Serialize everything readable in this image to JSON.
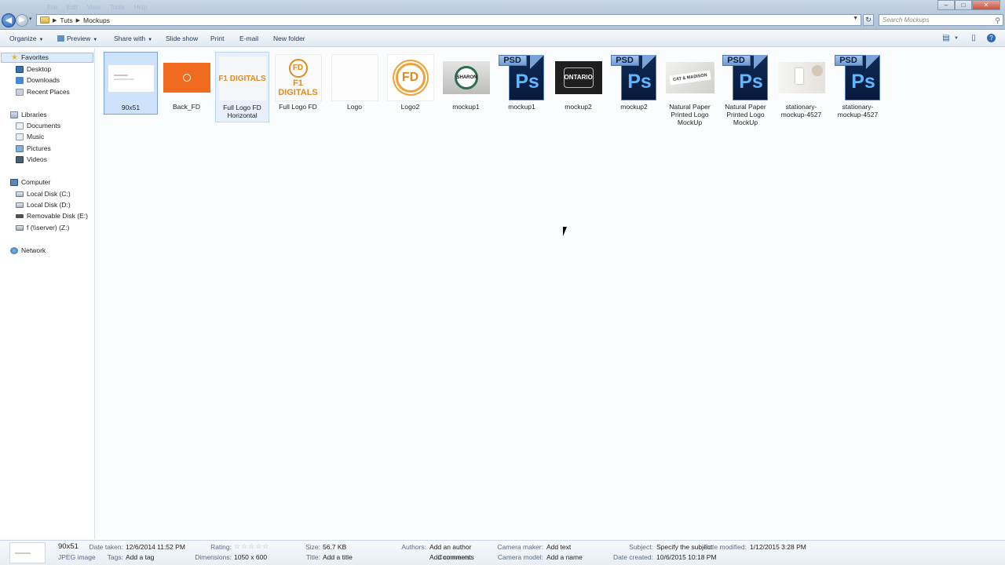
{
  "window": {
    "menu_ghost": [
      "File",
      "Edit",
      "View",
      "Tools",
      "Help"
    ],
    "controls": {
      "minimize": "–",
      "maximize": "□",
      "close": "✕"
    }
  },
  "address": {
    "breadcrumb": [
      "Tuts",
      "Mockups"
    ],
    "search_placeholder": "Search Mockups"
  },
  "toolbar": {
    "organize": "Organize",
    "preview": "Preview",
    "share_with": "Share with",
    "slide_show": "Slide show",
    "print": "Print",
    "email": "E-mail",
    "new_folder": "New folder"
  },
  "nav": {
    "favorites": {
      "label": "Favorites",
      "items": [
        "Desktop",
        "Downloads",
        "Recent Places"
      ]
    },
    "libraries": {
      "label": "Libraries",
      "items": [
        "Documents",
        "Music",
        "Pictures",
        "Videos"
      ]
    },
    "computer": {
      "label": "Computer",
      "items": [
        "Local Disk (C:)",
        "Local Disk (D:)",
        "Removable Disk (E:)",
        "f (\\\\server) (Z:)"
      ]
    },
    "network": {
      "label": "Network"
    }
  },
  "files": [
    {
      "name": "90x51",
      "kind": "card",
      "selected": true
    },
    {
      "name": "Back_FD",
      "kind": "orange"
    },
    {
      "name": "Full Logo FD Horizontal",
      "kind": "logo-h",
      "thumb_text": "F1 DIGITALS"
    },
    {
      "name": "Full Logo FD",
      "kind": "logo-v",
      "thumb_text": "F1 DIGITALS",
      "badge_text": "FD"
    },
    {
      "name": "Logo",
      "kind": "blank"
    },
    {
      "name": "Logo2",
      "kind": "logo2",
      "badge_text": "FD"
    },
    {
      "name": "mockup1",
      "kind": "badge",
      "thumb_text": "SHARON"
    },
    {
      "name": "mockup1",
      "kind": "psd"
    },
    {
      "name": "mockup2",
      "kind": "dark",
      "thumb_text": "ONTARIO"
    },
    {
      "name": "mockup2",
      "kind": "psd"
    },
    {
      "name": "Natural Paper Printed Logo MockUp",
      "kind": "paper",
      "thumb_text": "CAT & MADISON"
    },
    {
      "name": "Natural Paper Printed Logo MockUp",
      "kind": "psd"
    },
    {
      "name": "stationary-mockup-4527",
      "kind": "station"
    },
    {
      "name": "stationary-mockup-4527",
      "kind": "psd"
    }
  ],
  "psd_icon": {
    "tag": "PSD",
    "mark": "Ps"
  },
  "details": {
    "name": "90x51",
    "type": "JPEG image",
    "date_taken_label": "Date taken:",
    "date_taken": "12/6/2014 11:52 PM",
    "tags_label": "Tags:",
    "tags": "Add a tag",
    "rating_label": "Rating:",
    "rating_stars": "☆☆☆☆☆",
    "dimensions_label": "Dimensions:",
    "dimensions": "1050 x 600",
    "size_label": "Size:",
    "size": "56.7 KB",
    "title_label": "Title:",
    "title": "Add a title",
    "authors_label": "Authors:",
    "authors": "Add an author",
    "comments_label": "Comments:",
    "comments": "Add comments",
    "camera_maker_label": "Camera maker:",
    "camera_maker": "Add text",
    "camera_model_label": "Camera model:",
    "camera_model": "Add a name",
    "subject_label": "Subject:",
    "subject": "Specify the subject",
    "date_created_label": "Date created:",
    "date_created": "10/6/2015 10:18 PM",
    "date_modified_label": "Date modified:",
    "date_modified": "1/12/2015 3:28 PM"
  }
}
